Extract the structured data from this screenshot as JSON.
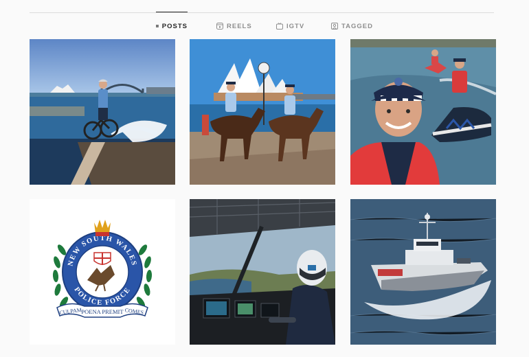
{
  "tabs": [
    {
      "label": "POSTS",
      "icon": "grid-icon",
      "active": true
    },
    {
      "label": "REELS",
      "icon": "reels-icon",
      "active": false
    },
    {
      "label": "IGTV",
      "icon": "igtv-icon",
      "active": false
    },
    {
      "label": "TAGGED",
      "icon": "tagged-icon",
      "active": false
    }
  ],
  "colors": {
    "active_tab": "#262626",
    "inactive_tab": "#8e8e8e",
    "divider": "#dbdbdb",
    "background": "#fafafa"
  },
  "posts": [
    {
      "subject": "bike-officer-harbour"
    },
    {
      "subject": "mounted-police-opera-house"
    },
    {
      "subject": "marine-officer-selfie-jetski"
    },
    {
      "subject": "nsw-police-crest"
    },
    {
      "subject": "helicopter-cockpit"
    },
    {
      "subject": "patrol-vessel"
    }
  ],
  "crest": {
    "top_text": "NEW SOUTH WALES",
    "bottom_text": "POLICE FORCE",
    "ribbon_left": "CULPAM",
    "ribbon_center": "POENA PREMIT",
    "ribbon_right": "COMES"
  }
}
